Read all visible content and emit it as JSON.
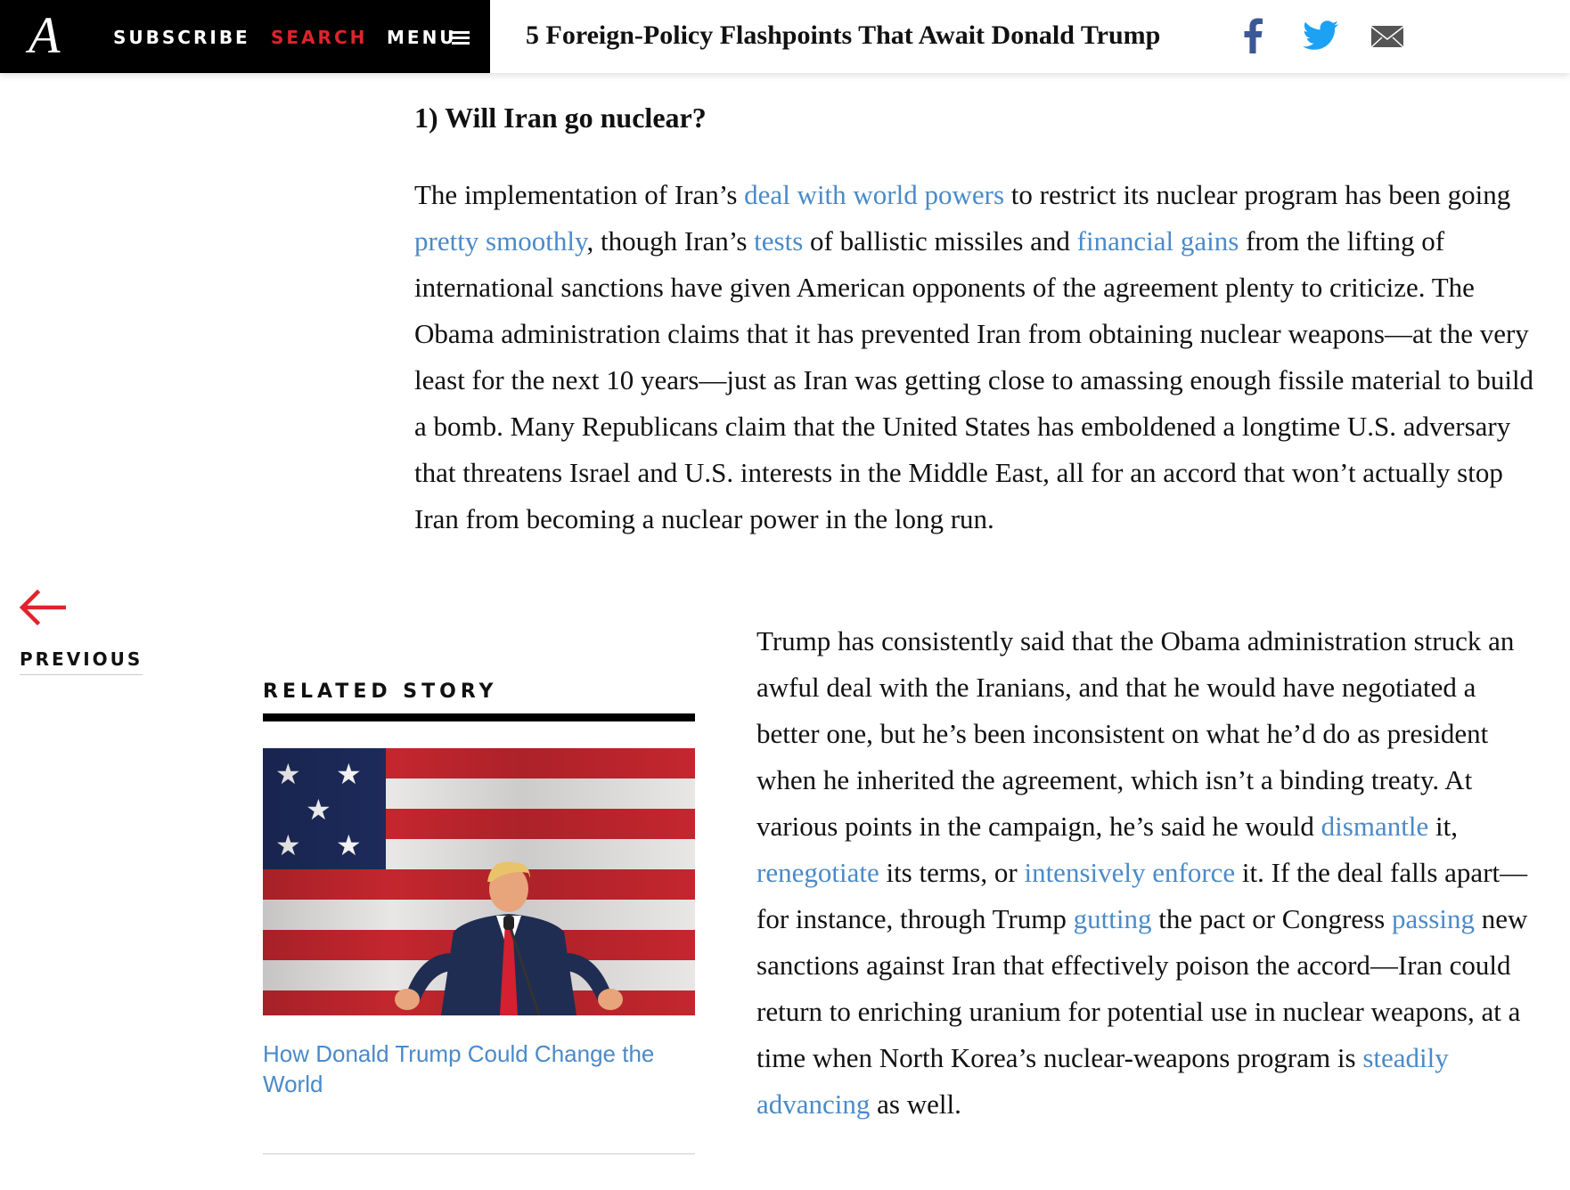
{
  "header": {
    "logo": "A",
    "nav": {
      "subscribe": "SUBSCRIBE",
      "search": "SEARCH",
      "menu": "MENU"
    },
    "article_title": "5 Foreign-Policy Flashpoints That Await Donald Trump",
    "share_icons": [
      "facebook-icon",
      "twitter-icon",
      "mail-icon"
    ]
  },
  "article": {
    "heading": "1) Will Iran go nuclear?",
    "para1": [
      {
        "t": "The implementation of Iran’s "
      },
      {
        "t": "deal with world powers",
        "link": true
      },
      {
        "t": " to restrict its nuclear program has been going "
      },
      {
        "t": "pretty smoothly",
        "link": true
      },
      {
        "t": ", though Iran’s "
      },
      {
        "t": "tests",
        "link": true
      },
      {
        "t": " of ballistic missiles and "
      },
      {
        "t": "financial gains",
        "link": true
      },
      {
        "t": " from the lifting of international sanctions have given American opponents of the agreement plenty to criticize. The Obama administration claims that it has prevented Iran from obtaining nuclear weapons—at the very least for the next 10 years—just as Iran was getting close to amassing enough fissile material to build a bomb. Many Republicans claim that the United States has emboldened a longtime U.S. adversary that threatens Israel and U.S. interests in the Middle East, all for an accord that won’t actually stop Iran from becoming a nuclear power in the long run."
      }
    ],
    "para2": [
      {
        "t": "Trump has consistently said that the Obama administration struck an awful deal with the Iranians, and that he would have negotiated a better one, but he’s been inconsistent on what he’d do as president when he inherited the agreement, which isn’t a binding treaty. At various points in the campaign, he’s said he would "
      },
      {
        "t": "dismantle",
        "link": true
      },
      {
        "t": " it, "
      },
      {
        "t": "renegotiate",
        "link": true
      },
      {
        "t": " its terms, or "
      },
      {
        "t": "intensively enforce",
        "link": true
      },
      {
        "t": " it. If the deal falls apart—for instance, through Trump "
      },
      {
        "t": "gutting",
        "link": true
      },
      {
        "t": " the pact or Congress "
      },
      {
        "t": "passing",
        "link": true
      },
      {
        "t": " new sanctions against Iran that effectively poison the accord—Iran could return to enriching uranium for potential use in nuclear weapons, at a time when North Korea’s nuclear-weapons program is "
      },
      {
        "t": "steadily advancing",
        "link": true
      },
      {
        "t": " as well."
      }
    ]
  },
  "previous": {
    "label": "PREVIOUS",
    "icon": "left-arrow-icon"
  },
  "related": {
    "heading": "RELATED STORY",
    "link_text": "How Donald Trump Could Change the World"
  },
  "colors": {
    "link": "#4a8ac9",
    "accent_red": "#e0232c",
    "header_black": "#000000",
    "flag_red": "#c4262e",
    "flag_blue": "#1d2b5c"
  }
}
